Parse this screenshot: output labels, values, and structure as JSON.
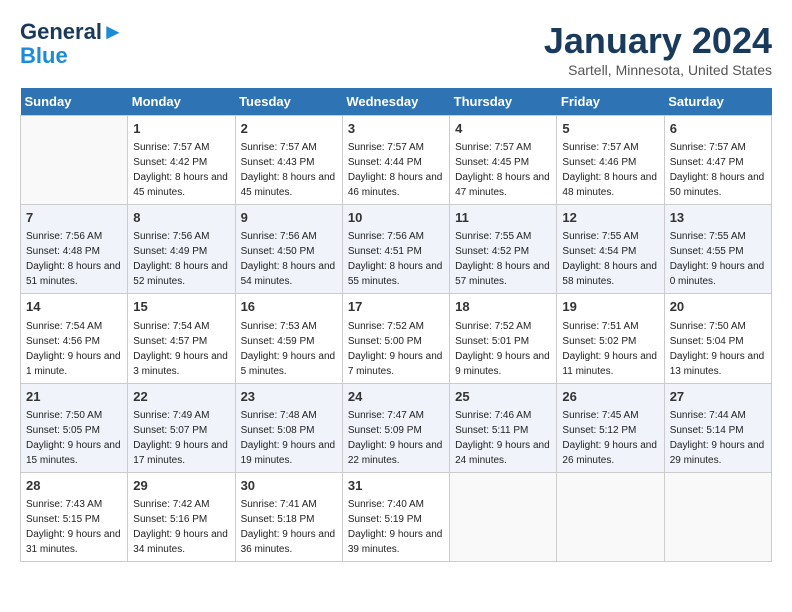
{
  "header": {
    "logo_line1": "General",
    "logo_line2": "Blue",
    "month": "January 2024",
    "location": "Sartell, Minnesota, United States"
  },
  "days_of_week": [
    "Sunday",
    "Monday",
    "Tuesday",
    "Wednesday",
    "Thursday",
    "Friday",
    "Saturday"
  ],
  "weeks": [
    [
      {
        "day": "",
        "sunrise": "",
        "sunset": "",
        "daylight": ""
      },
      {
        "day": "1",
        "sunrise": "Sunrise: 7:57 AM",
        "sunset": "Sunset: 4:42 PM",
        "daylight": "Daylight: 8 hours and 45 minutes."
      },
      {
        "day": "2",
        "sunrise": "Sunrise: 7:57 AM",
        "sunset": "Sunset: 4:43 PM",
        "daylight": "Daylight: 8 hours and 45 minutes."
      },
      {
        "day": "3",
        "sunrise": "Sunrise: 7:57 AM",
        "sunset": "Sunset: 4:44 PM",
        "daylight": "Daylight: 8 hours and 46 minutes."
      },
      {
        "day": "4",
        "sunrise": "Sunrise: 7:57 AM",
        "sunset": "Sunset: 4:45 PM",
        "daylight": "Daylight: 8 hours and 47 minutes."
      },
      {
        "day": "5",
        "sunrise": "Sunrise: 7:57 AM",
        "sunset": "Sunset: 4:46 PM",
        "daylight": "Daylight: 8 hours and 48 minutes."
      },
      {
        "day": "6",
        "sunrise": "Sunrise: 7:57 AM",
        "sunset": "Sunset: 4:47 PM",
        "daylight": "Daylight: 8 hours and 50 minutes."
      }
    ],
    [
      {
        "day": "7",
        "sunrise": "Sunrise: 7:56 AM",
        "sunset": "Sunset: 4:48 PM",
        "daylight": "Daylight: 8 hours and 51 minutes."
      },
      {
        "day": "8",
        "sunrise": "Sunrise: 7:56 AM",
        "sunset": "Sunset: 4:49 PM",
        "daylight": "Daylight: 8 hours and 52 minutes."
      },
      {
        "day": "9",
        "sunrise": "Sunrise: 7:56 AM",
        "sunset": "Sunset: 4:50 PM",
        "daylight": "Daylight: 8 hours and 54 minutes."
      },
      {
        "day": "10",
        "sunrise": "Sunrise: 7:56 AM",
        "sunset": "Sunset: 4:51 PM",
        "daylight": "Daylight: 8 hours and 55 minutes."
      },
      {
        "day": "11",
        "sunrise": "Sunrise: 7:55 AM",
        "sunset": "Sunset: 4:52 PM",
        "daylight": "Daylight: 8 hours and 57 minutes."
      },
      {
        "day": "12",
        "sunrise": "Sunrise: 7:55 AM",
        "sunset": "Sunset: 4:54 PM",
        "daylight": "Daylight: 8 hours and 58 minutes."
      },
      {
        "day": "13",
        "sunrise": "Sunrise: 7:55 AM",
        "sunset": "Sunset: 4:55 PM",
        "daylight": "Daylight: 9 hours and 0 minutes."
      }
    ],
    [
      {
        "day": "14",
        "sunrise": "Sunrise: 7:54 AM",
        "sunset": "Sunset: 4:56 PM",
        "daylight": "Daylight: 9 hours and 1 minute."
      },
      {
        "day": "15",
        "sunrise": "Sunrise: 7:54 AM",
        "sunset": "Sunset: 4:57 PM",
        "daylight": "Daylight: 9 hours and 3 minutes."
      },
      {
        "day": "16",
        "sunrise": "Sunrise: 7:53 AM",
        "sunset": "Sunset: 4:59 PM",
        "daylight": "Daylight: 9 hours and 5 minutes."
      },
      {
        "day": "17",
        "sunrise": "Sunrise: 7:52 AM",
        "sunset": "Sunset: 5:00 PM",
        "daylight": "Daylight: 9 hours and 7 minutes."
      },
      {
        "day": "18",
        "sunrise": "Sunrise: 7:52 AM",
        "sunset": "Sunset: 5:01 PM",
        "daylight": "Daylight: 9 hours and 9 minutes."
      },
      {
        "day": "19",
        "sunrise": "Sunrise: 7:51 AM",
        "sunset": "Sunset: 5:02 PM",
        "daylight": "Daylight: 9 hours and 11 minutes."
      },
      {
        "day": "20",
        "sunrise": "Sunrise: 7:50 AM",
        "sunset": "Sunset: 5:04 PM",
        "daylight": "Daylight: 9 hours and 13 minutes."
      }
    ],
    [
      {
        "day": "21",
        "sunrise": "Sunrise: 7:50 AM",
        "sunset": "Sunset: 5:05 PM",
        "daylight": "Daylight: 9 hours and 15 minutes."
      },
      {
        "day": "22",
        "sunrise": "Sunrise: 7:49 AM",
        "sunset": "Sunset: 5:07 PM",
        "daylight": "Daylight: 9 hours and 17 minutes."
      },
      {
        "day": "23",
        "sunrise": "Sunrise: 7:48 AM",
        "sunset": "Sunset: 5:08 PM",
        "daylight": "Daylight: 9 hours and 19 minutes."
      },
      {
        "day": "24",
        "sunrise": "Sunrise: 7:47 AM",
        "sunset": "Sunset: 5:09 PM",
        "daylight": "Daylight: 9 hours and 22 minutes."
      },
      {
        "day": "25",
        "sunrise": "Sunrise: 7:46 AM",
        "sunset": "Sunset: 5:11 PM",
        "daylight": "Daylight: 9 hours and 24 minutes."
      },
      {
        "day": "26",
        "sunrise": "Sunrise: 7:45 AM",
        "sunset": "Sunset: 5:12 PM",
        "daylight": "Daylight: 9 hours and 26 minutes."
      },
      {
        "day": "27",
        "sunrise": "Sunrise: 7:44 AM",
        "sunset": "Sunset: 5:14 PM",
        "daylight": "Daylight: 9 hours and 29 minutes."
      }
    ],
    [
      {
        "day": "28",
        "sunrise": "Sunrise: 7:43 AM",
        "sunset": "Sunset: 5:15 PM",
        "daylight": "Daylight: 9 hours and 31 minutes."
      },
      {
        "day": "29",
        "sunrise": "Sunrise: 7:42 AM",
        "sunset": "Sunset: 5:16 PM",
        "daylight": "Daylight: 9 hours and 34 minutes."
      },
      {
        "day": "30",
        "sunrise": "Sunrise: 7:41 AM",
        "sunset": "Sunset: 5:18 PM",
        "daylight": "Daylight: 9 hours and 36 minutes."
      },
      {
        "day": "31",
        "sunrise": "Sunrise: 7:40 AM",
        "sunset": "Sunset: 5:19 PM",
        "daylight": "Daylight: 9 hours and 39 minutes."
      },
      {
        "day": "",
        "sunrise": "",
        "sunset": "",
        "daylight": ""
      },
      {
        "day": "",
        "sunrise": "",
        "sunset": "",
        "daylight": ""
      },
      {
        "day": "",
        "sunrise": "",
        "sunset": "",
        "daylight": ""
      }
    ]
  ]
}
